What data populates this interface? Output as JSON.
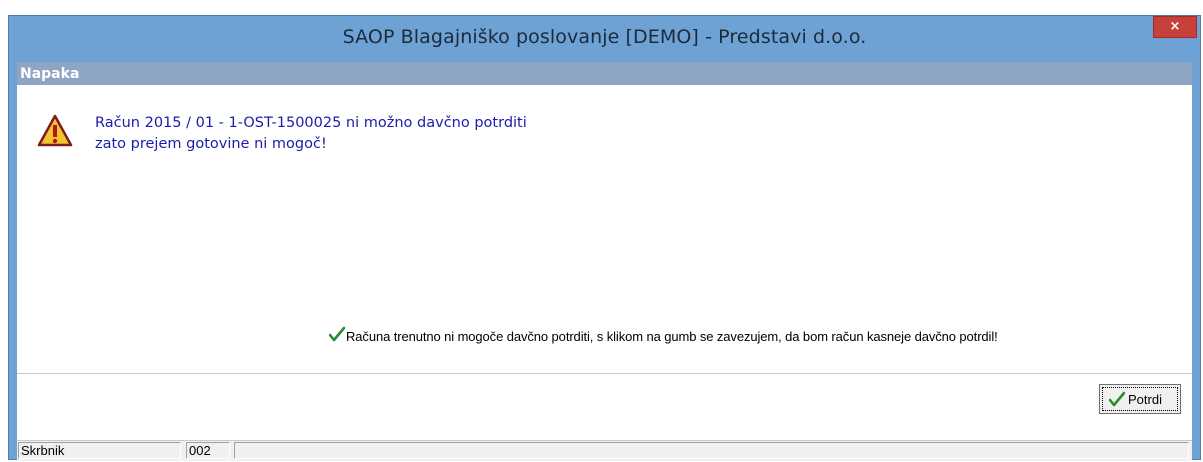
{
  "window": {
    "title": "SAOP Blagajniško poslovanje [DEMO] - Predstavi  d.o.o.",
    "close_label": "×",
    "accent_color": "#6fa2d4"
  },
  "panel": {
    "header": "Napaka"
  },
  "message": {
    "icon": "warning-icon",
    "line1": "Račun  2015 / 01 - 1-OST-1500025  ni možno davčno potrditi",
    "line2": "zato prejem gotovine ni mogoč!"
  },
  "notice": {
    "icon": "checkmark-icon",
    "text": "Računa trenutno ni mogoče davčno potrditi, s klikom na gumb se zavezujem, da bom račun kasneje davčno potrdil!"
  },
  "buttons": {
    "confirm_label": "Potrdi"
  },
  "statusbar": {
    "user": "Skrbnik",
    "code": "002",
    "extra": ""
  }
}
